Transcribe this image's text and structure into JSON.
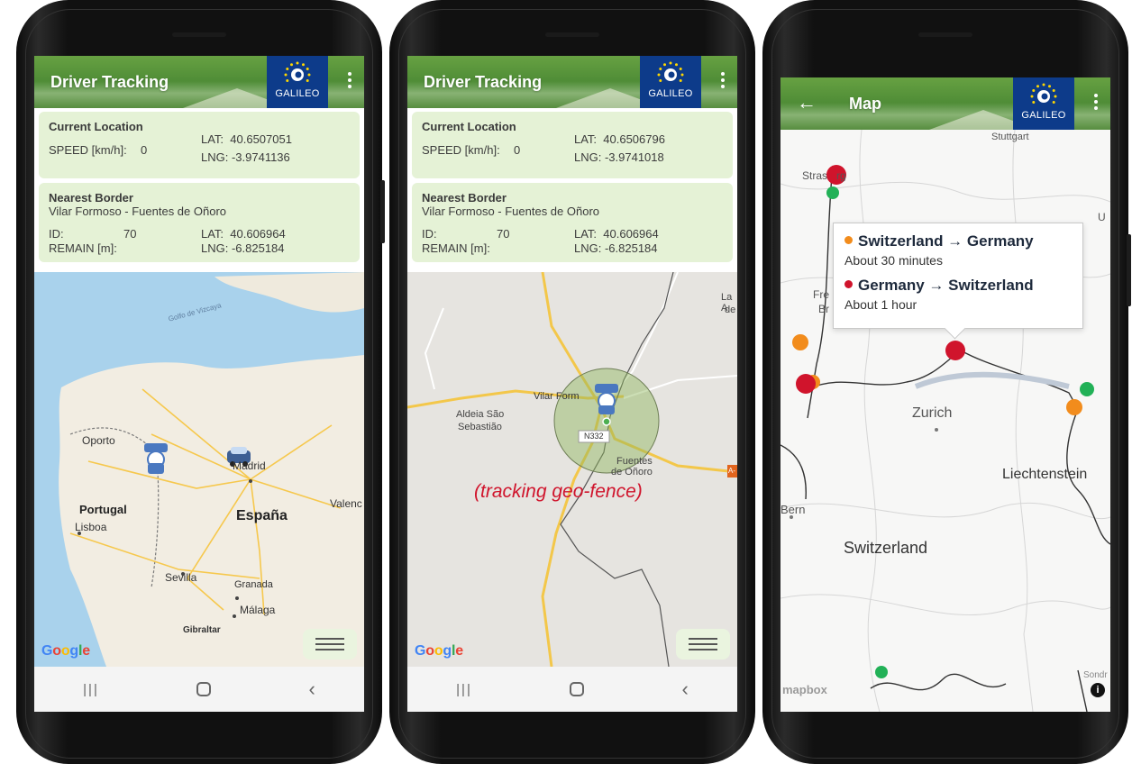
{
  "colors": {
    "appbar_green": "#4c8a35",
    "card_bg": "#e5f2d6",
    "galileo_blue": "#0d3b8a",
    "crossing_orange": "#f28c1c",
    "crossing_red": "#d0142c",
    "crossing_green": "#22b157",
    "geofence_red": "#d0142c"
  },
  "screens": [
    {
      "title": "Driver Tracking",
      "logo": "GALILEO",
      "current_location": {
        "heading": "Current Location",
        "speed_label": "SPEED [km/h]:",
        "speed_value": "0",
        "lat": "LAT:  40.6507051",
        "lng": "LNG: -3.9741136"
      },
      "nearest_border": {
        "heading": "Nearest Border",
        "name": "Vilar Formoso - Fuentes de Oñoro",
        "id_label": "ID:",
        "id_value": "70",
        "remain_label": "REMAIN [m]:",
        "lat": "LAT:  40.606964",
        "lng": "LNG: -6.825184"
      },
      "map_labels": {
        "gulf": "Golfo de Vizcaya",
        "oporto": "Oporto",
        "madrid": "Madrid",
        "portugal": "Portugal",
        "espana": "España",
        "valencia": "Valenc",
        "lisboa": "Lisboa",
        "sevilla": "Sevilla",
        "granada": "Granada",
        "malaga": "Málaga",
        "gibraltar": "Gibraltar"
      },
      "google": "Google"
    },
    {
      "title": "Driver Tracking",
      "logo": "GALILEO",
      "current_location": {
        "heading": "Current Location",
        "speed_label": "SPEED [km/h]:",
        "speed_value": "0",
        "lat": "LAT:  40.6506796",
        "lng": "LNG: -3.9741018"
      },
      "nearest_border": {
        "heading": "Nearest Border",
        "name": "Vilar Formoso - Fuentes de Oñoro",
        "id_label": "ID:",
        "id_value": "70",
        "remain_label": "REMAIN [m]:",
        "lat": "LAT:  40.606964",
        "lng": "LNG: -6.825184"
      },
      "map_labels": {
        "vilar": "Vilar Form",
        "aldeia1": "Aldeia São",
        "aldeia2": "Sebastião",
        "road": "N332",
        "fuentes1": "Fuentes",
        "fuentes2": "de Oñoro",
        "la_top": "La A",
        "la_bottom": "de",
        "edge_road": "A-",
        "geofence": "(tracking geo-fence)"
      },
      "google": "Google"
    },
    {
      "title": "Map",
      "logo": "GALILEO",
      "tooltip": {
        "line1": "Switzerland → Germany",
        "sub1": "About 30 minutes",
        "line2": "Germany → Switzerland",
        "sub2": "About 1 hour"
      },
      "map_labels": {
        "stuttgart": "Stuttgart",
        "strasbourg": "Stras   rg",
        "fre": "Fre",
        "br": "Br",
        "zurich": "Zurich",
        "liechtenstein": "Liechtenstein",
        "bern": "Bern",
        "switzerland": "Switzerland",
        "mapbox": "mapbox",
        "sondr": "Sondr",
        "u": "U"
      }
    }
  ]
}
